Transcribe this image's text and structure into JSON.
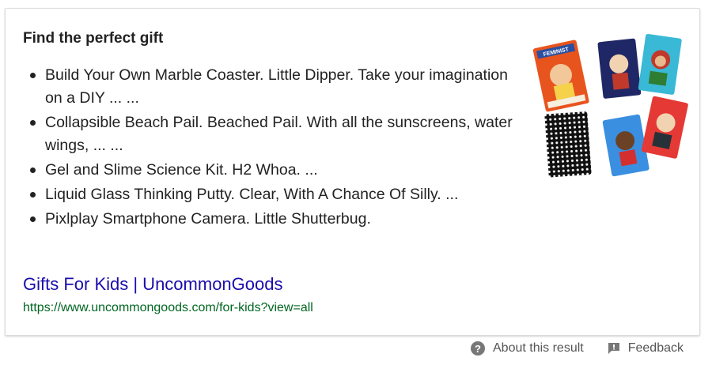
{
  "snippet": {
    "heading": "Find the perfect gift",
    "items": [
      "Build Your Own Marble Coaster. Little Dipper. Take your imagination on a DIY ... ...",
      "Collapsible Beach Pail. Beached Pail. With all the sunscreens, water wings, ... ...",
      "Gel and Slime Science Kit. H2 Whoa. ...",
      "Liquid Glass Thinking Putty. Clear, With A Chance Of Silly. ...",
      "Pixlplay Smartphone Camera. Little Shutterbug."
    ],
    "link_title": "Gifts For Kids | UncommonGoods",
    "url": "https://www.uncommongoods.com/for-kids?view=all",
    "thumbnail_box_title": "FEMINIST"
  },
  "footer": {
    "about_label": "About this result",
    "feedback_label": "Feedback"
  },
  "colors": {
    "link": "#1a0dab",
    "url": "#006621",
    "text": "#222222"
  },
  "icons": {
    "about": "question-circle-icon",
    "feedback": "feedback-flag-icon"
  }
}
